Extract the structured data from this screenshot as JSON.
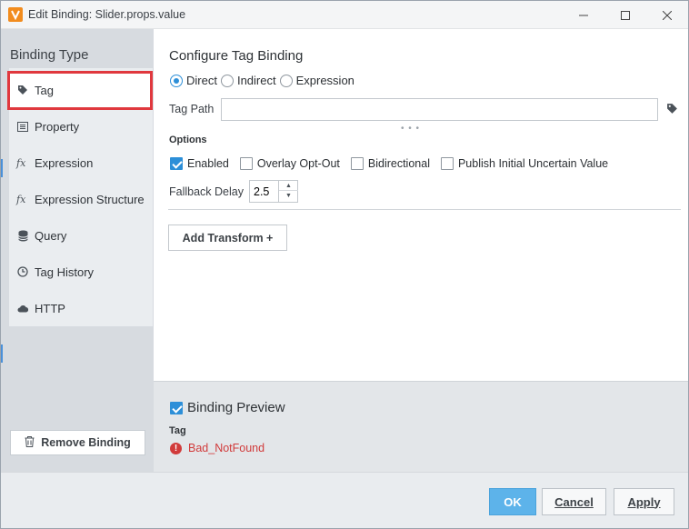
{
  "window": {
    "title": "Edit Binding: Slider.props.value"
  },
  "left_panel": {
    "heading": "Binding Type",
    "items": [
      {
        "label": "Tag",
        "icon": "tag-icon",
        "selected": true
      },
      {
        "label": "Property",
        "icon": "list-icon"
      },
      {
        "label": "Expression",
        "icon": "fx-icon"
      },
      {
        "label": "Expression Structure",
        "icon": "fx-icon"
      },
      {
        "label": "Query",
        "icon": "database-icon"
      },
      {
        "label": "Tag History",
        "icon": "clock-icon"
      },
      {
        "label": "HTTP",
        "icon": "cloud-icon"
      }
    ],
    "remove_button": "Remove Binding"
  },
  "config": {
    "title": "Configure Tag Binding",
    "modes": [
      {
        "label": "Direct",
        "selected": true
      },
      {
        "label": "Indirect",
        "selected": false
      },
      {
        "label": "Expression",
        "selected": false
      }
    ],
    "tag_path": {
      "label": "Tag Path",
      "value": ""
    },
    "options_label": "Options",
    "options": [
      {
        "label": "Enabled",
        "checked": true
      },
      {
        "label": "Overlay Opt-Out",
        "checked": false
      },
      {
        "label": "Bidirectional",
        "checked": false
      },
      {
        "label": "Publish Initial Uncertain Value",
        "checked": false
      }
    ],
    "fallback_delay": {
      "label": "Fallback Delay",
      "value": "2.5"
    },
    "add_transform": "Add Transform +"
  },
  "preview": {
    "title": "Binding Preview",
    "checked": true,
    "sub_label": "Tag",
    "status": "Bad_NotFound",
    "status_color": "#d13b3b"
  },
  "footer": {
    "ok": "OK",
    "cancel": "Cancel",
    "apply": "Apply"
  },
  "colors": {
    "accent": "#2d8fd8",
    "ok_button": "#5db3ea",
    "selection_outline": "#e0383e"
  }
}
